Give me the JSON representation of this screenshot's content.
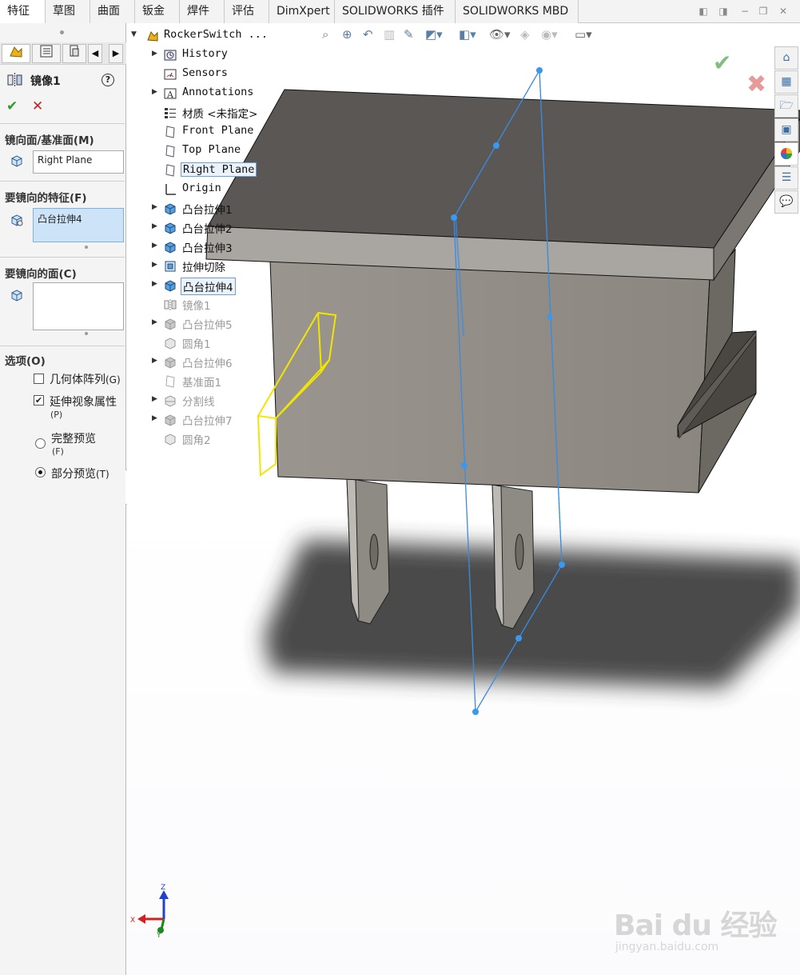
{
  "tabs": [
    "特征",
    "草图",
    "曲面",
    "钣金",
    "焊件",
    "评估",
    "DimXpert",
    "SOLIDWORKS 插件",
    "SOLIDWORKS MBD"
  ],
  "property_manager": {
    "title": "镜像1",
    "help": "?",
    "ok_symbol": "✔",
    "cancel_symbol": "✕",
    "mirror_plane_header": "镜向面/基准面(M)",
    "mirror_plane_value": "Right Plane",
    "features_header": "要镜向的特征(F)",
    "features_value": "凸台拉伸4",
    "faces_header": "要镜向的面(C)",
    "options_header": "选项(O)",
    "geometry_pattern": {
      "label": "几何体阵列",
      "key": "(G)",
      "checked": false
    },
    "propagate_visual": {
      "label": "延伸视象属性",
      "key": "(P)",
      "checked": true
    },
    "full_preview": {
      "label": "完整预览",
      "key": "(F)",
      "selected": false
    },
    "partial_preview": {
      "label": "部分预览",
      "key": "(T)",
      "selected": true
    }
  },
  "tree": {
    "root": "RockerSwitch  ...",
    "items": [
      {
        "label": "History",
        "icon": "history-icon",
        "expand": true,
        "cn": false
      },
      {
        "label": "Sensors",
        "icon": "sensor-icon",
        "expand": false,
        "cn": false
      },
      {
        "label": "Annotations",
        "icon": "annotation-icon",
        "expand": true,
        "cn": false
      },
      {
        "label": "材质 <未指定>",
        "icon": "material-icon",
        "expand": false,
        "cn": true
      },
      {
        "label": "Front Plane",
        "icon": "plane-icon",
        "expand": false,
        "cn": false
      },
      {
        "label": "Top Plane",
        "icon": "plane-icon",
        "expand": false,
        "cn": false
      },
      {
        "label": "Right Plane",
        "icon": "plane-icon",
        "expand": false,
        "cn": false,
        "boxed": true
      },
      {
        "label": "Origin",
        "icon": "origin-icon",
        "expand": false,
        "cn": false
      },
      {
        "label": "凸台拉伸1",
        "icon": "boss-extrude-icon",
        "expand": true,
        "cn": true
      },
      {
        "label": "凸台拉伸2",
        "icon": "boss-extrude-icon",
        "expand": true,
        "cn": true
      },
      {
        "label": "凸台拉伸3",
        "icon": "boss-extrude-icon",
        "expand": true,
        "cn": true
      },
      {
        "label": "拉伸切除",
        "icon": "cut-extrude-icon",
        "expand": true,
        "cn": true
      },
      {
        "label": "凸台拉伸4",
        "icon": "boss-extrude-icon",
        "expand": true,
        "cn": true,
        "boxed": true
      },
      {
        "label": "镜像1",
        "icon": "mirror-icon",
        "expand": false,
        "cn": true,
        "suppressed": true
      },
      {
        "label": "凸台拉伸5",
        "icon": "boss-extrude-icon",
        "expand": true,
        "cn": true,
        "suppressed": true
      },
      {
        "label": "圆角1",
        "icon": "fillet-icon",
        "expand": false,
        "cn": true,
        "suppressed": true
      },
      {
        "label": "凸台拉伸6",
        "icon": "boss-extrude-icon",
        "expand": true,
        "cn": true,
        "suppressed": true
      },
      {
        "label": "基准面1",
        "icon": "plane-icon",
        "expand": false,
        "cn": true,
        "suppressed": true
      },
      {
        "label": "分割线",
        "icon": "split-line-icon",
        "expand": true,
        "cn": true,
        "suppressed": true
      },
      {
        "label": "凸台拉伸7",
        "icon": "boss-extrude-icon",
        "expand": true,
        "cn": true,
        "suppressed": true
      },
      {
        "label": "圆角2",
        "icon": "fillet-icon",
        "expand": false,
        "cn": true,
        "suppressed": true
      }
    ]
  },
  "triad": {
    "z": "Z",
    "x": "X",
    "y": "Y"
  },
  "watermark": {
    "main": "Bai du 经验",
    "sub": "jingyan.baidu.com"
  }
}
